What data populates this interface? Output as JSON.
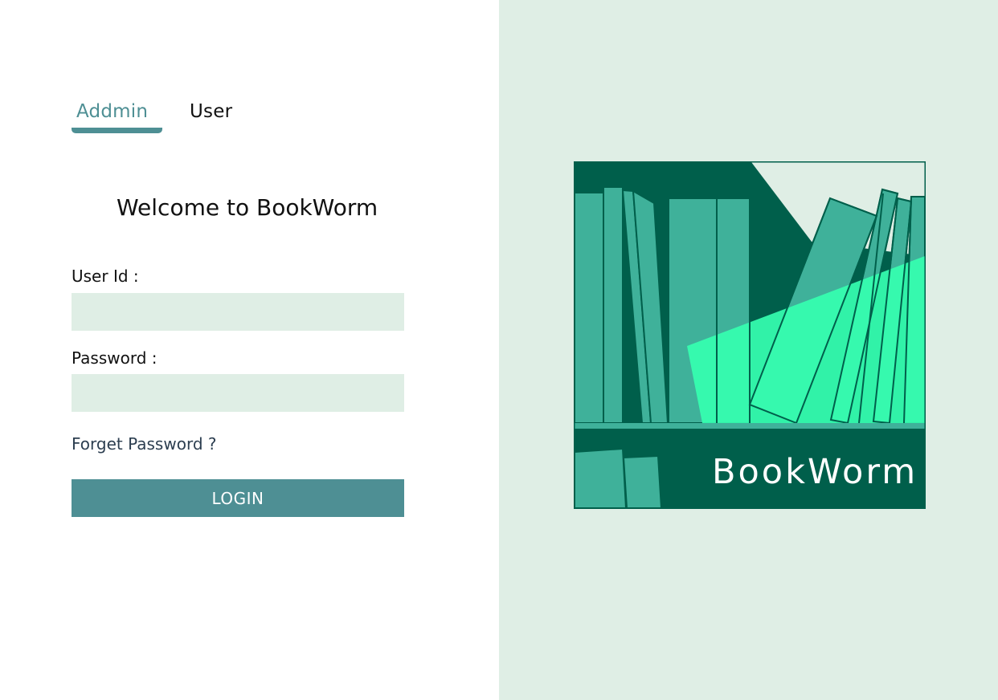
{
  "tabs": {
    "admin_label": "Addmin",
    "user_label": "User"
  },
  "form": {
    "title": "Welcome to BookWorm",
    "user_id_label": "User Id :",
    "user_id_value": "",
    "password_label": "Password :",
    "password_value": "",
    "forgot_label": "Forget Password ?",
    "login_label": "LOGIN"
  },
  "logo": {
    "text": "BookWorm"
  },
  "colors": {
    "accent": "#4e8f94",
    "field_bg": "#dfeee5",
    "panel_bg": "#dfeee5",
    "logo_dark": "#005f4b",
    "book_mid": "#3fb19a",
    "book_bright": "#35ffb0"
  }
}
